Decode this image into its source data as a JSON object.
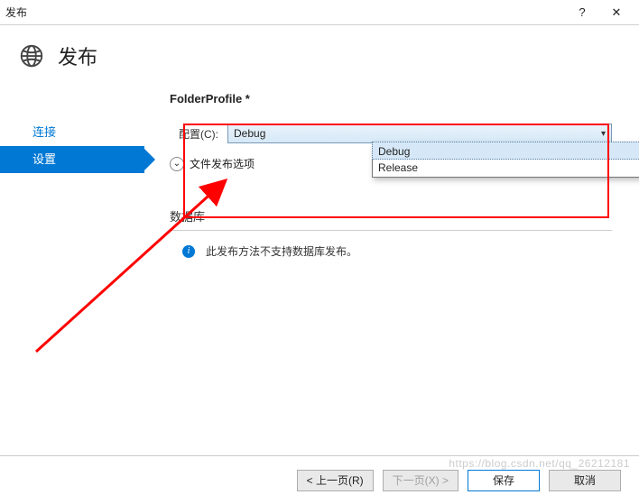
{
  "titlebar": {
    "title": "发布",
    "help": "?",
    "close": "✕"
  },
  "header": {
    "title": "发布"
  },
  "sidebar": {
    "items": [
      {
        "label": "连接",
        "active": false
      },
      {
        "label": "设置",
        "active": true
      }
    ]
  },
  "main": {
    "profile_name": "FolderProfile *",
    "config_label": "配置(C):",
    "config_value": "Debug",
    "config_options": [
      "Debug",
      "Release"
    ],
    "expander_label": "文件发布选项",
    "db_header": "数据库",
    "db_info": "此发布方法不支持数据库发布。"
  },
  "footer": {
    "prev": "< 上一页(R)",
    "next": "下一页(X) >",
    "save": "保存",
    "cancel": "取消"
  },
  "watermark": "https://blog.csdn.net/qq_26212181"
}
